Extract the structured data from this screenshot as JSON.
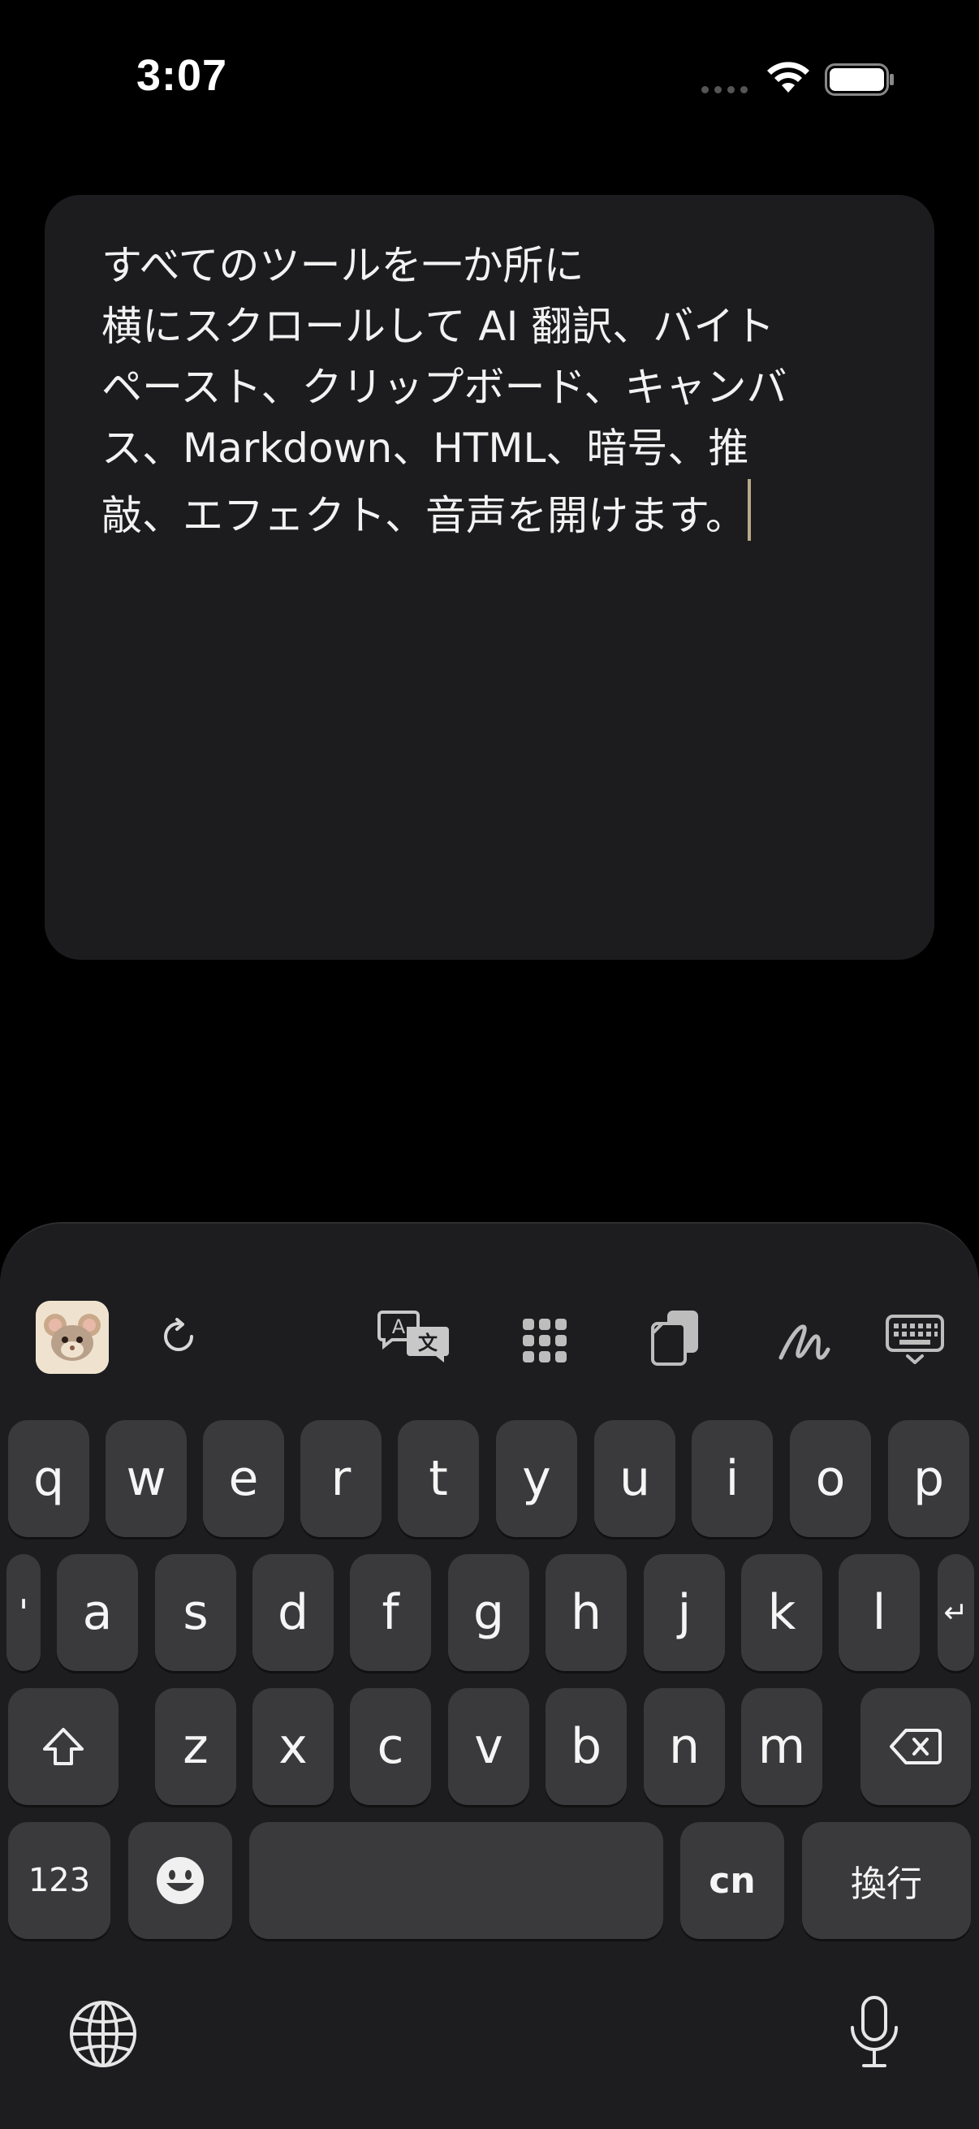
{
  "status": {
    "time": "3:07"
  },
  "editor": {
    "lines": [
      "すべてのツールを一か所に",
      "横にスクロールして AI 翻訳、バイト",
      "ペースト、クリップボード、キャンバ",
      "ス、Markdown、HTML、暗号、推",
      "敲、エフェクト、音声を開けます。"
    ]
  },
  "toolbar": {
    "icons": [
      "app-avatar",
      "refresh-icon",
      "translate-icon",
      "grid-icon",
      "clipboard-icon",
      "handwriting-icon",
      "keyboard-hide-icon"
    ]
  },
  "keyboard": {
    "row1": [
      "q",
      "w",
      "e",
      "r",
      "t",
      "y",
      "u",
      "i",
      "o",
      "p"
    ],
    "row2": [
      "'",
      "a",
      "s",
      "d",
      "f",
      "g",
      "h",
      "j",
      "k",
      "l",
      "↵"
    ],
    "row3": [
      "z",
      "x",
      "c",
      "v",
      "b",
      "n",
      "m"
    ],
    "numbers_label": "123",
    "lang_label": "cn",
    "return_label": "換行",
    "space_label": ""
  }
}
